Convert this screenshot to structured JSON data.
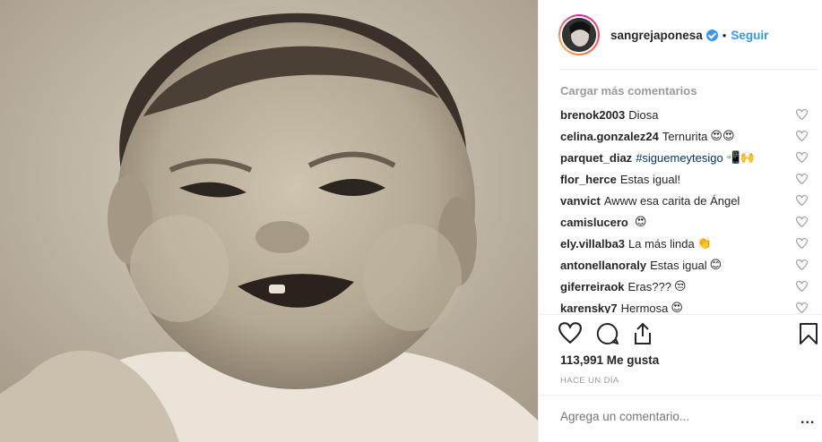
{
  "post": {
    "username": "sangrejaponesa",
    "verified": true,
    "dot": "•",
    "follow_label": "Seguir",
    "load_more_label": "Cargar más comentarios",
    "comments": [
      {
        "user": "brenok2003",
        "text": "Diosa",
        "emoji": ""
      },
      {
        "user": "celina.gonzalez24",
        "text": "Ternurita",
        "emoji": "😍😍"
      },
      {
        "user": "parquet_diaz",
        "text": "#siguemeytesigo",
        "emoji": "📲🙌",
        "is_tag": true
      },
      {
        "user": "flor_herce",
        "text": "Estas igual!",
        "emoji": ""
      },
      {
        "user": "vanvict",
        "text": "Awww esa carita de Ángel",
        "emoji": ""
      },
      {
        "user": "camislucero",
        "text": "",
        "emoji": "😍"
      },
      {
        "user": "ely.villalba3",
        "text": "La más linda",
        "emoji": "👏"
      },
      {
        "user": "antonellanoraly",
        "text": "Estas igual",
        "emoji": "😊"
      },
      {
        "user": "giferreiraok",
        "text": "Eras???",
        "emoji": "😒"
      },
      {
        "user": "karensky7",
        "text": "Hermosa",
        "emoji": "😍"
      }
    ],
    "likes_label": "113,991 Me gusta",
    "time_label": "HACE UN DÍA",
    "add_comment_placeholder": "Agrega un comentario...",
    "more_label": "..."
  },
  "colors": {
    "accent": "#3897f0",
    "text": "#262626",
    "muted": "#999999"
  },
  "icons": {
    "like": "heart-outline-icon",
    "comment": "speech-bubble-icon",
    "share": "share-upload-icon",
    "save": "bookmark-icon",
    "verified": "verified-badge-icon"
  }
}
